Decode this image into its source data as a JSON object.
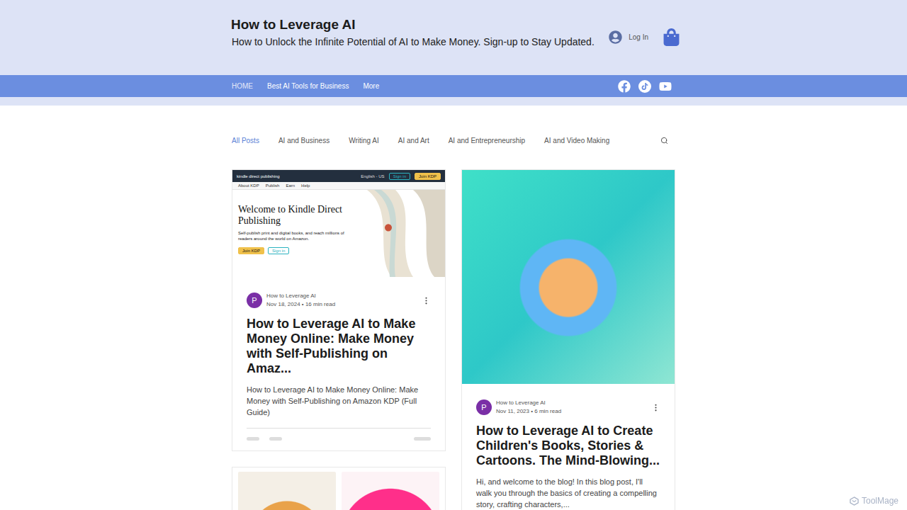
{
  "site": {
    "title": "How to Leverage AI",
    "tagline": "How to Unlock the Infinite Potential of AI to Make Money. Sign-up to Stay Updated.",
    "login": "Log In"
  },
  "nav": {
    "items": [
      {
        "label": "HOME",
        "selected": true
      },
      {
        "label": "Best AI Tools for Business",
        "selected": false
      },
      {
        "label": "More",
        "selected": false
      }
    ]
  },
  "categories": [
    {
      "label": "All Posts",
      "selected": true
    },
    {
      "label": "AI and Business",
      "selected": false
    },
    {
      "label": "Writing AI",
      "selected": false
    },
    {
      "label": "AI and Art",
      "selected": false
    },
    {
      "label": "AI and Entrepreneurship",
      "selected": false
    },
    {
      "label": "AI and Video Making",
      "selected": false
    }
  ],
  "columns": [
    [
      {
        "kind": "kdp",
        "author": "How to Leverage AI",
        "avatar": "P",
        "date": "Nov 18, 2024",
        "read": "16 min read",
        "separator": "•",
        "title": "How to Leverage AI to Make Money Online: Make Money with Self-Publishing on Amaz...",
        "excerpt": "How to Leverage AI to Make Money Online: Make Money with Self-Publishing on Amazon KDP (Full Guide)",
        "stats_loading": true,
        "cover": {
          "brand": "kindle direct publishing",
          "language": "English - US",
          "header_buttons": [
            "Sign in",
            "Join KDP"
          ],
          "tabs": [
            "About KDP",
            "Publish",
            "Earn",
            "Help"
          ],
          "heading": "Welcome to Kindle Direct Publishing",
          "body": "Self-publish print and digital books, and reach millions of readers around the world on Amazon.",
          "buttons": [
            "Join KDP",
            "Sign in"
          ]
        }
      },
      {
        "kind": "pair"
      }
    ],
    [
      {
        "kind": "illustration",
        "author": "How to Leverage AI",
        "avatar": "P",
        "date": "Nov 11, 2023",
        "read": "6 min read",
        "separator": "•",
        "title": "How to Leverage AI to Create Children's Books, Stories & Cartoons. The Mind-Blowing...",
        "excerpt": "Hi, and welcome to the blog! In this blog post, I'll walk you through the basics of creating a compelling story, crafting characters,...",
        "stats_loading": true
      }
    ]
  ],
  "watermark": "ToolMage"
}
